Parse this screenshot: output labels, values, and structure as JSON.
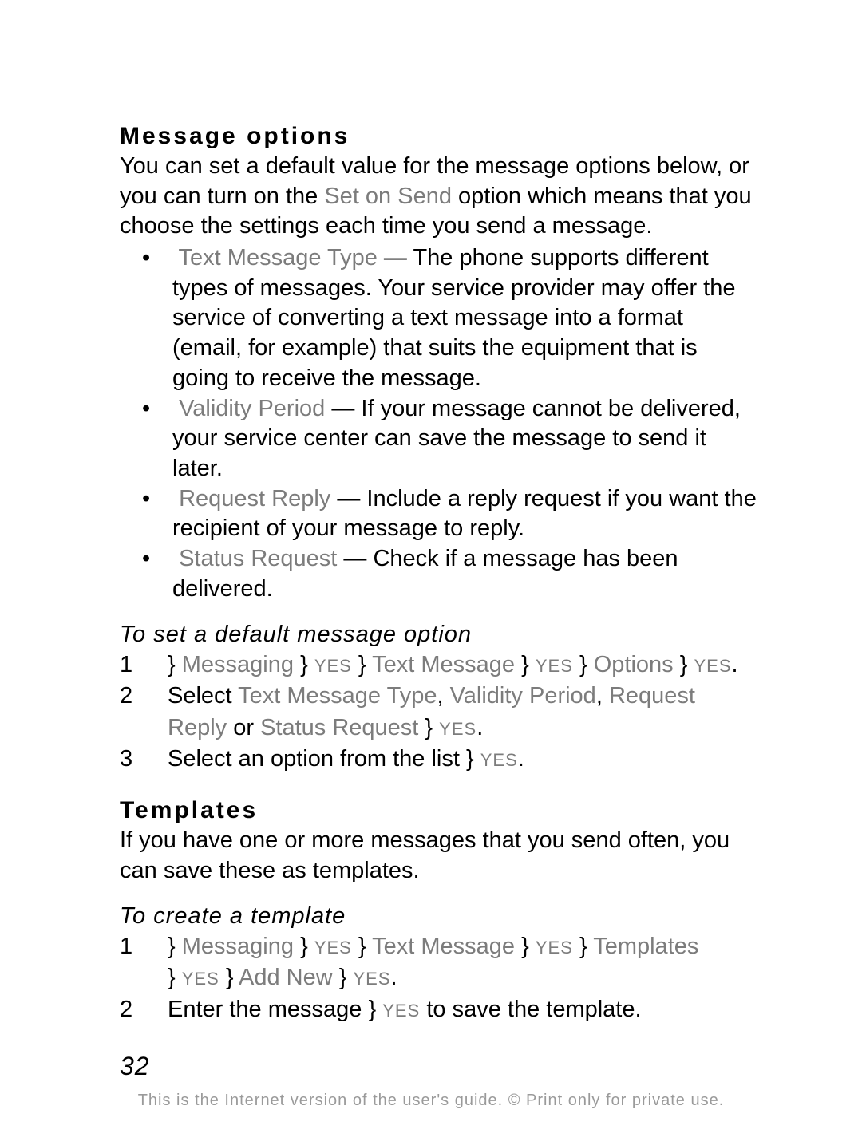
{
  "headings": {
    "message_options": "Message options",
    "templates": "Templates"
  },
  "paragraphs": {
    "mo_intro_a": "You can set a default value for the message options below, or you can turn on the ",
    "mo_intro_set_on_send": "Set on Send",
    "mo_intro_b": " option which means that you choose the settings each time you send a message.",
    "templates_intro": "If you have one or more messages that you send often, you can save these as templates."
  },
  "options": [
    {
      "label": "Text Message Type",
      "desc": " — The phone supports different types of messages. Your service provider may offer the service of converting a text message into a format (email, for example) that suits the equipment that is going to receive the message."
    },
    {
      "label": "Validity Period",
      "desc": " — If your message cannot be delivered, your service center can save the message to send it later."
    },
    {
      "label": "Request Reply",
      "desc": " — Include a reply request if you want the recipient of your message to reply."
    },
    {
      "label": "Status Request",
      "desc": " — Check if a message has been delivered."
    }
  ],
  "labels": {
    "text_message_type": "Text Message Type",
    "validity_period": "Validity Period",
    "request_reply": "Request Reply",
    "status_request": "Status Request",
    "messaging": "Messaging",
    "text_message": "Text Message",
    "options_menu": "Options",
    "templates_menu": "Templates",
    "add_new": "Add New"
  },
  "keys": {
    "yes": "YES"
  },
  "symbols": {
    "arrow": "}"
  },
  "procedures": {
    "set_default": {
      "title": "To set a default message option",
      "step2_a": "Select ",
      "step2_b": " or ",
      "step3_a": "Select an option from the list "
    },
    "create_template": {
      "title": "To create a template",
      "step2_a": "Enter the message ",
      "step2_b": " to save the template."
    }
  },
  "page_number": "32",
  "footer": "This is the Internet version of the user's guide. © Print only for private use."
}
